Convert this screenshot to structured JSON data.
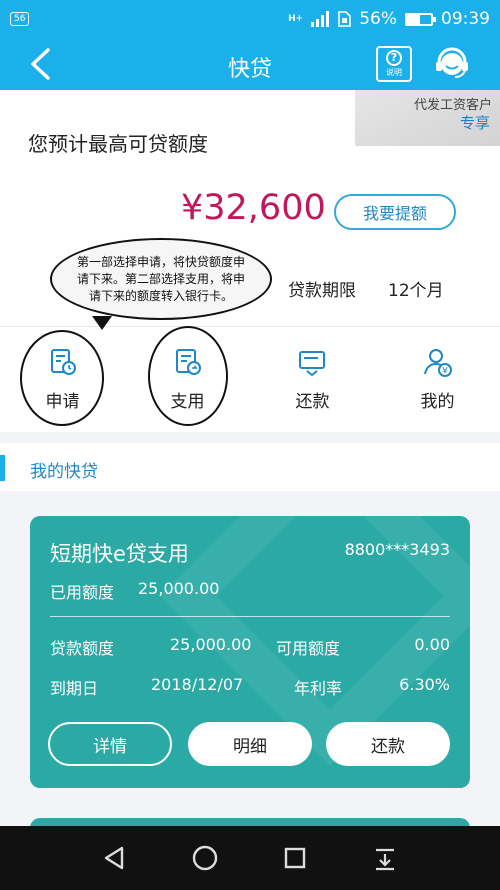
{
  "status_bar": {
    "badge": "56",
    "network": "H+",
    "battery": "56%",
    "battery_level": 0.56,
    "time": "09:39"
  },
  "nav": {
    "title": "快贷",
    "help_label": "说明"
  },
  "corner_tag": {
    "line1": "代发工资客户",
    "line2": "专享"
  },
  "quota": {
    "title": "您预计最高可贷额度",
    "amount": "¥32,600",
    "raise_button": "我要提额",
    "term_label": "贷款期限",
    "term_value": "12个月"
  },
  "annotation": {
    "text": "第一部选择申请，将快贷额度申请下来。第二部选择支用，将申请下来的额度转入银行卡。"
  },
  "actions": [
    {
      "label": "申请",
      "icon": "apply-calendar-icon"
    },
    {
      "label": "支用",
      "icon": "withdraw-arrow-icon"
    },
    {
      "label": "还款",
      "icon": "repay-card-icon"
    },
    {
      "label": "我的",
      "icon": "user-yen-icon"
    }
  ],
  "my_loans": {
    "title": "我的快贷"
  },
  "loan_card": {
    "name": "短期快e贷支用",
    "account": "8800***3493",
    "used_label": "已用额度",
    "used_value": "25,000.00",
    "loan_amount_label": "贷款额度",
    "loan_amount_value": "25,000.00",
    "available_label": "可用额度",
    "available_value": "0.00",
    "due_label": "到期日",
    "due_value": "2018/12/07",
    "rate_label": "年利率",
    "rate_value": "6.30%",
    "buttons": [
      "详情",
      "明细",
      "还款"
    ]
  },
  "colors": {
    "header": "#1bb0ea",
    "amount": "#c2185b",
    "card": "#2aa9a5",
    "accent_text": "#1e88c7"
  }
}
